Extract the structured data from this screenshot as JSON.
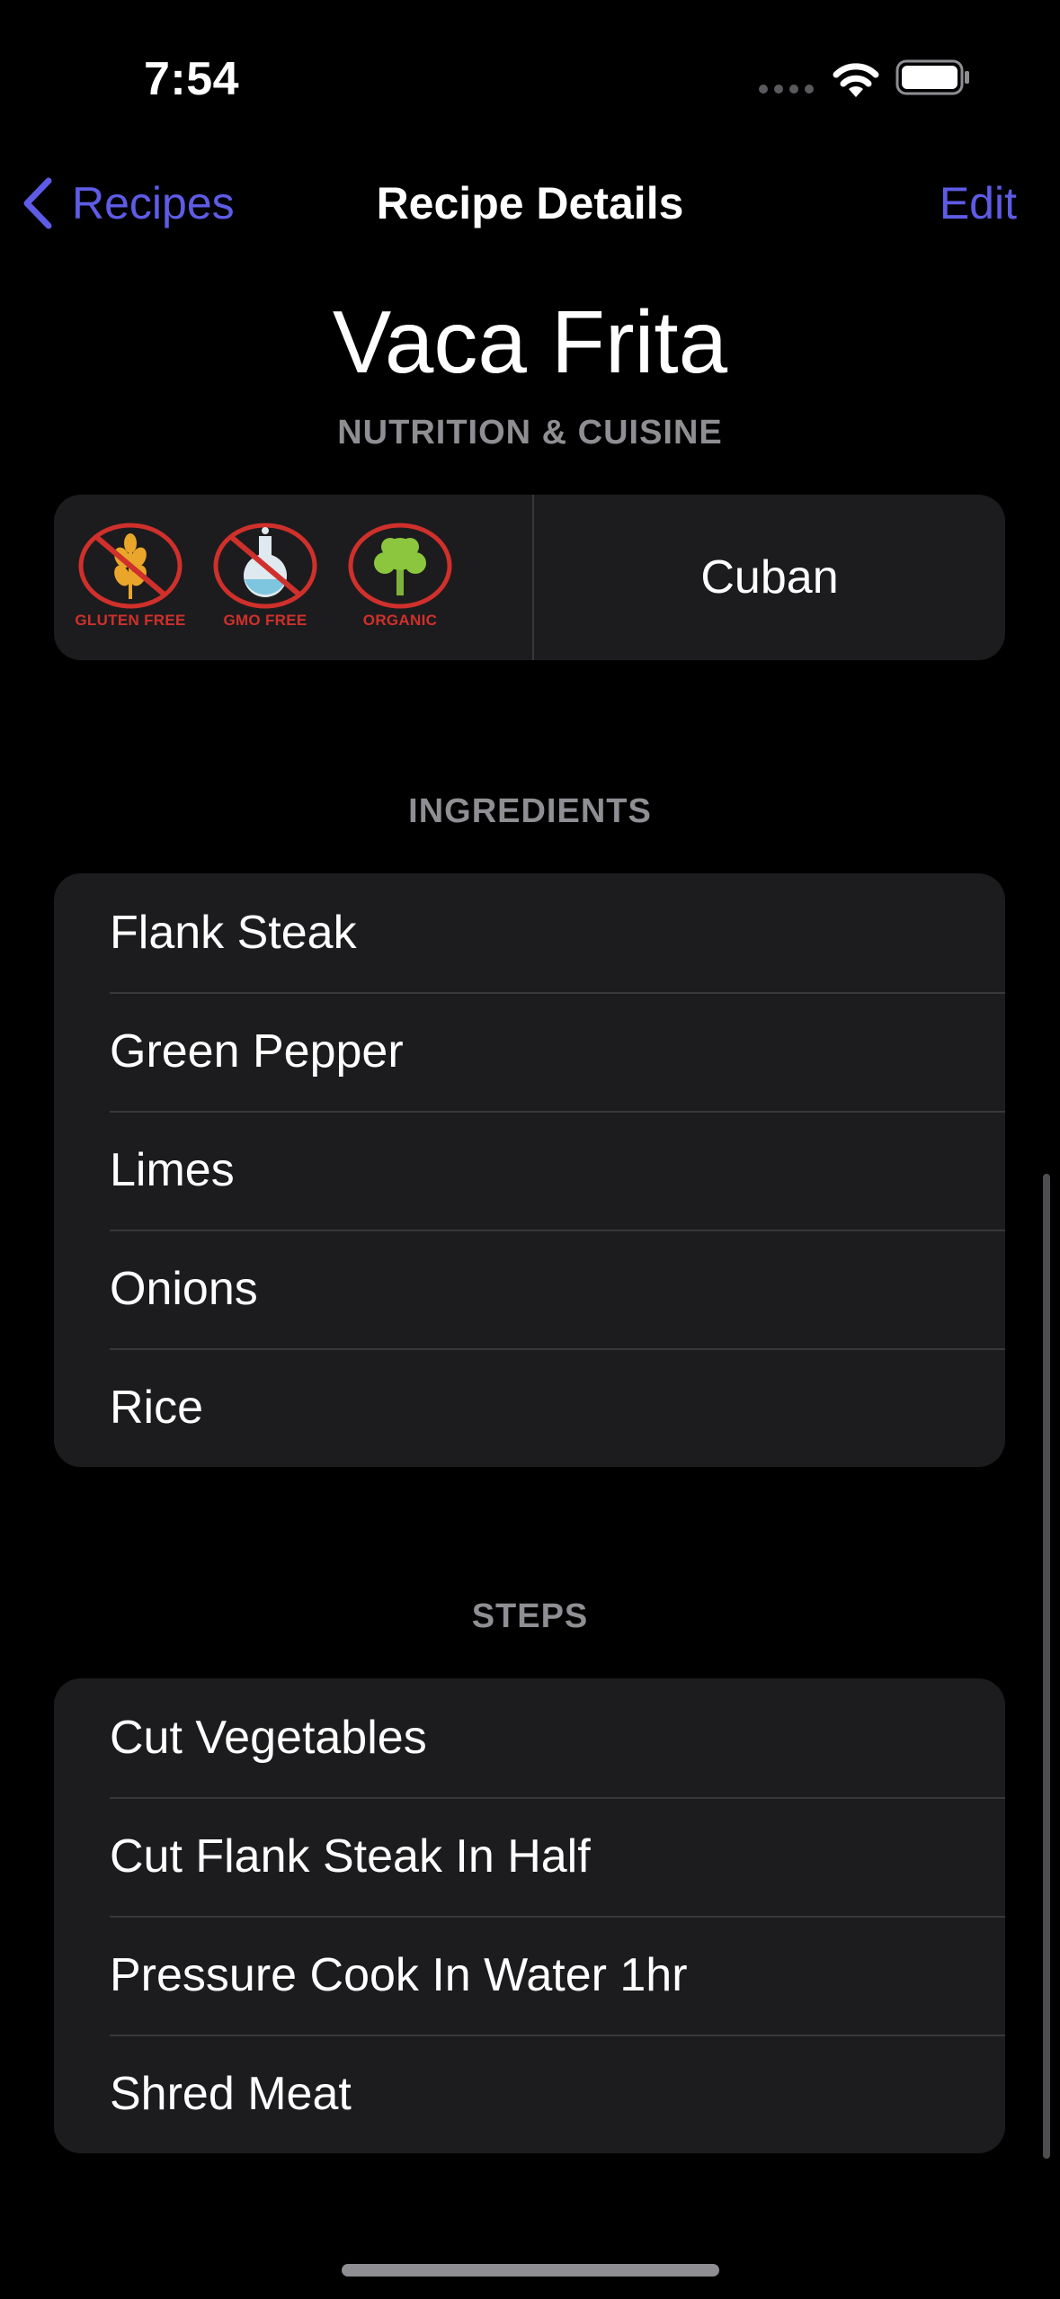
{
  "status_bar": {
    "time": "7:54"
  },
  "nav": {
    "back_label": "Recipes",
    "title": "Recipe Details",
    "edit_label": "Edit"
  },
  "recipe": {
    "name": "Vaca Frita"
  },
  "nutrition": {
    "header": "NUTRITION & CUISINE",
    "badges": [
      {
        "icon": "gluten-free-icon",
        "label": "GLUTEN FREE"
      },
      {
        "icon": "gmo-free-icon",
        "label": "GMO FREE"
      },
      {
        "icon": "organic-icon",
        "label": "ORGANIC"
      }
    ],
    "cuisine": "Cuban"
  },
  "ingredients": {
    "header": "INGREDIENTS",
    "items": [
      "Flank Steak",
      "Green Pepper",
      "Limes",
      "Onions",
      "Rice"
    ]
  },
  "steps": {
    "header": "STEPS",
    "items": [
      "Cut Vegetables",
      "Cut Flank Steak In Half",
      "Pressure Cook In Water 1hr",
      "Shred Meat"
    ]
  },
  "colors": {
    "accent": "#5e5ce6",
    "card": "#1c1c1e",
    "secondary_text": "#8e8e93",
    "badge_red": "#d0302b"
  }
}
